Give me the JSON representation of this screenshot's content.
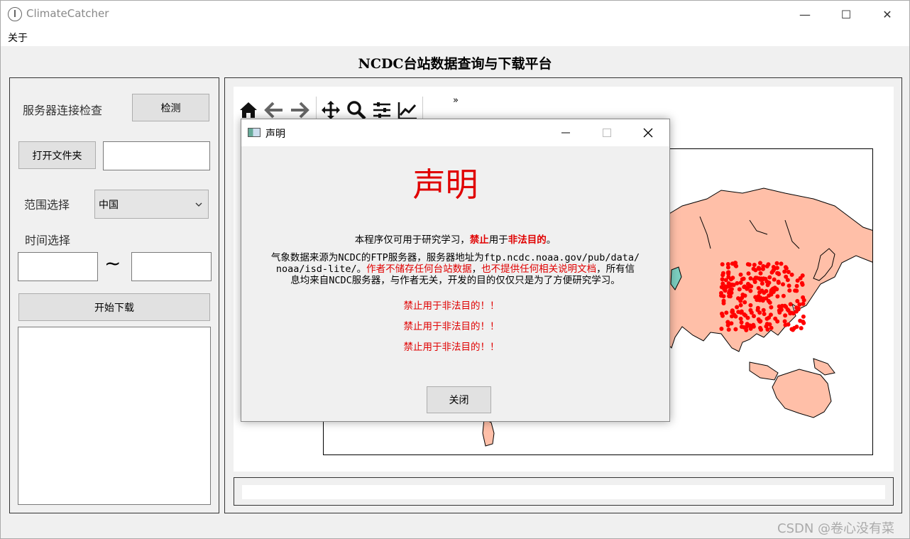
{
  "window": {
    "app_title": "ClimateCatcher",
    "minimize": "—",
    "maximize": "☐",
    "close": "✕"
  },
  "menu": {
    "about": "关于"
  },
  "main_title": "NCDC台站数据查询与下载平台",
  "left": {
    "server_check_label": "服务器连接检查",
    "check_button": "检测",
    "open_folder_button": "打开文件夹",
    "folder_value": "",
    "range_label": "范围选择",
    "range_selected": "中国",
    "time_label": "时间选择",
    "time_start": "",
    "tilde": "~",
    "time_end": "",
    "start_download_button": "开始下载",
    "log_text": ""
  },
  "toolbar": {
    "icons": [
      "home-icon",
      "back-icon",
      "forward-icon",
      "pan-icon",
      "zoom-icon",
      "configure-subplots-icon",
      "edit-axis-icon"
    ],
    "overflow": "»"
  },
  "dialog": {
    "title": "声明",
    "heading": "声明",
    "line1_prefix": "本程序仅可用于研究学习，",
    "line1_forbid": "禁止",
    "line1_mid": "用于",
    "line1_illegal": "非法目的",
    "line1_end": "。",
    "para_a": "气象数据来源为NCDC的FTP服务器，服务器地址为ftp.ncdc.noaa.gov/pub/data/",
    "para_b_prefix": "noaa/isd-lite/。",
    "para_b_red1": "作者不储存任何台站数据",
    "para_b_sep": "，",
    "para_b_red2": "也不提供任何相关说明文档",
    "para_b_suffix": "，所有信",
    "para_c": "息均来自NCDC服务器，与作者无关，开发的目的仅仅只是为了方便研究学习。",
    "warning1": "禁止用于非法目的！！",
    "warning2": "禁止用于非法目的！！",
    "warning3": "禁止用于非法目的！！",
    "close_button": "关闭"
  },
  "map": {
    "land_color": "#ffbfa8",
    "station_color": "#ff0000"
  },
  "watermark": "CSDN @卷心没有菜"
}
